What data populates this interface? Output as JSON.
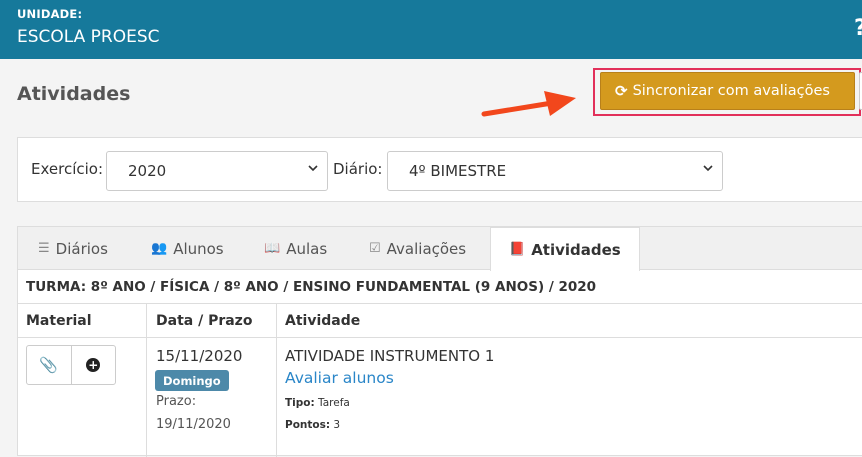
{
  "header": {
    "unit_label": "UNIDADE:",
    "unit_name": "ESCOLA PROESC",
    "help_icon": "question-icon"
  },
  "page": {
    "title": "Atividades",
    "sync_button_label": "Sincronizar com avaliações",
    "sync_icon": "refresh-icon"
  },
  "filters": {
    "exercicio_label": "Exercício:",
    "exercicio_value": "2020",
    "diario_label": "Diário:",
    "diario_value": "4º BIMESTRE"
  },
  "tabs": [
    {
      "label": "Diários",
      "icon": "list-icon",
      "active": false
    },
    {
      "label": "Alunos",
      "icon": "users-icon",
      "active": false
    },
    {
      "label": "Aulas",
      "icon": "book-open-icon",
      "active": false
    },
    {
      "label": "Avaliações",
      "icon": "check-square-icon",
      "active": false
    },
    {
      "label": "Atividades",
      "icon": "book-icon",
      "active": true
    }
  ],
  "turma": "TURMA: 8º ANO / FÍSICA / 8º ANO / ENSINO FUNDAMENTAL (9 ANOS) / 2020",
  "table": {
    "headers": [
      "Material",
      "Data / Prazo",
      "Atividade"
    ],
    "rows": [
      {
        "date": "15/11/2020",
        "day_badge": "Domingo",
        "prazo_label": "Prazo:",
        "prazo_date": "19/11/2020",
        "activity_name": "ATIVIDADE INSTRUMENTO 1",
        "action_link": "Avaliar alunos",
        "tipo_label": "Tipo:",
        "tipo_value": "Tarefa",
        "pontos_label": "Pontos:",
        "pontos_value": "3"
      }
    ]
  },
  "colors": {
    "header_bg": "#16799b",
    "sync_button": "#d49a1e",
    "highlight_border": "#e2305a",
    "arrow": "#f2471c",
    "badge": "#4d89a9",
    "link": "#2a86c8"
  }
}
